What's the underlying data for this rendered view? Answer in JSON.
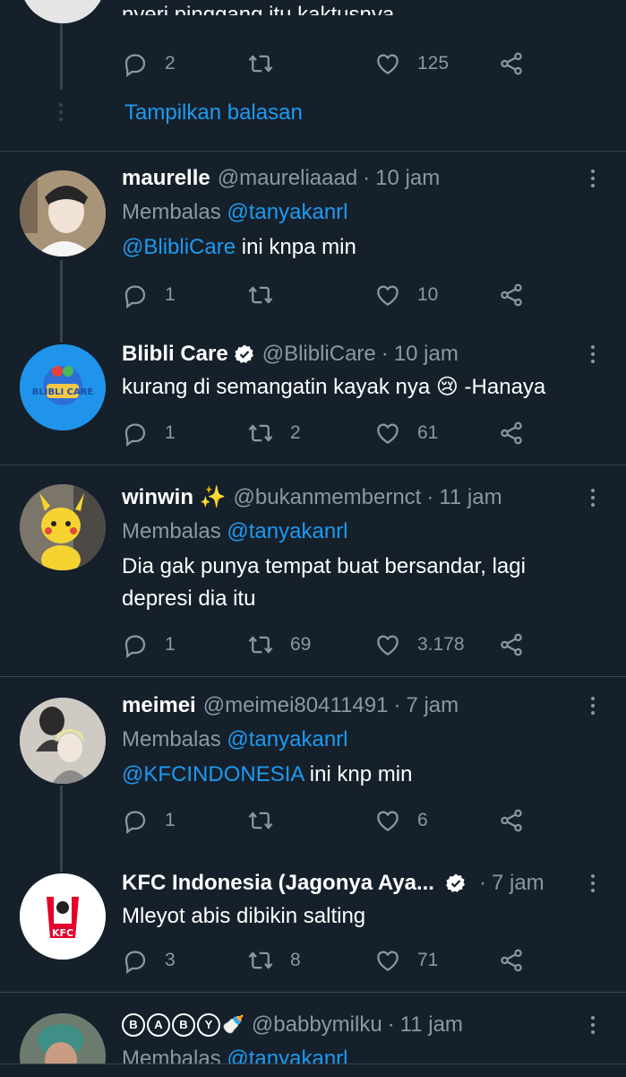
{
  "top_tweet": {
    "text": "nyeri pinggang itu kaktusnya",
    "reply_count": "2",
    "retweet_count": "",
    "like_count": "125",
    "show_replies_label": "Tampilkan balasan"
  },
  "tweets": [
    {
      "name": "maurelle",
      "handle": "@maureliaaad",
      "time": "10 jam",
      "replying_prefix": "Membalas",
      "replying_to": "@tanyakanrl",
      "mention": "@BlibliCare",
      "text": " ini knpa min",
      "reply_count": "1",
      "retweet_count": "",
      "like_count": "10"
    },
    {
      "name": "Blibli Care",
      "handle": "@BlibliCare",
      "time": "10 jam",
      "text": "kurang di semangatin kayak nya 😢 -Hanaya",
      "reply_count": "1",
      "retweet_count": "2",
      "like_count": "61",
      "avatar_label": "BLIBLI CARE"
    },
    {
      "name": "winwin ✨",
      "handle": "@bukanmembernct",
      "time": "11 jam",
      "replying_prefix": "Membalas",
      "replying_to": "@tanyakanrl",
      "text_line1": "Dia gak punya tempat buat bersandar, lagi",
      "text_line2": "depresi dia itu",
      "reply_count": "1",
      "retweet_count": "69",
      "like_count": "3.178"
    },
    {
      "name": "meimei",
      "handle": "@meimei80411491",
      "time": "7 jam",
      "replying_prefix": "Membalas",
      "replying_to": "@tanyakanrl",
      "mention": "@KFCINDONESIA",
      "text": " ini knp min",
      "reply_count": "1",
      "retweet_count": "",
      "like_count": "6"
    },
    {
      "name": "KFC Indonesia (Jagonya Aya...",
      "handle": "",
      "time": "7 jam",
      "text": "Mleyot abis dibikin salting",
      "reply_count": "3",
      "retweet_count": "8",
      "like_count": "71",
      "avatar_label": "KFC"
    },
    {
      "name_letters": [
        "B",
        "A",
        "B",
        "Y"
      ],
      "name_emoji": "🍼",
      "handle": "@babbymilku",
      "time": "11 jam",
      "replying_prefix": "Membalas",
      "replying_to": "@tanyakanrl"
    }
  ],
  "colors": {
    "background": "#15202b",
    "accent": "#1d9bf0",
    "muted": "#8899a6",
    "divider": "#38444d"
  }
}
